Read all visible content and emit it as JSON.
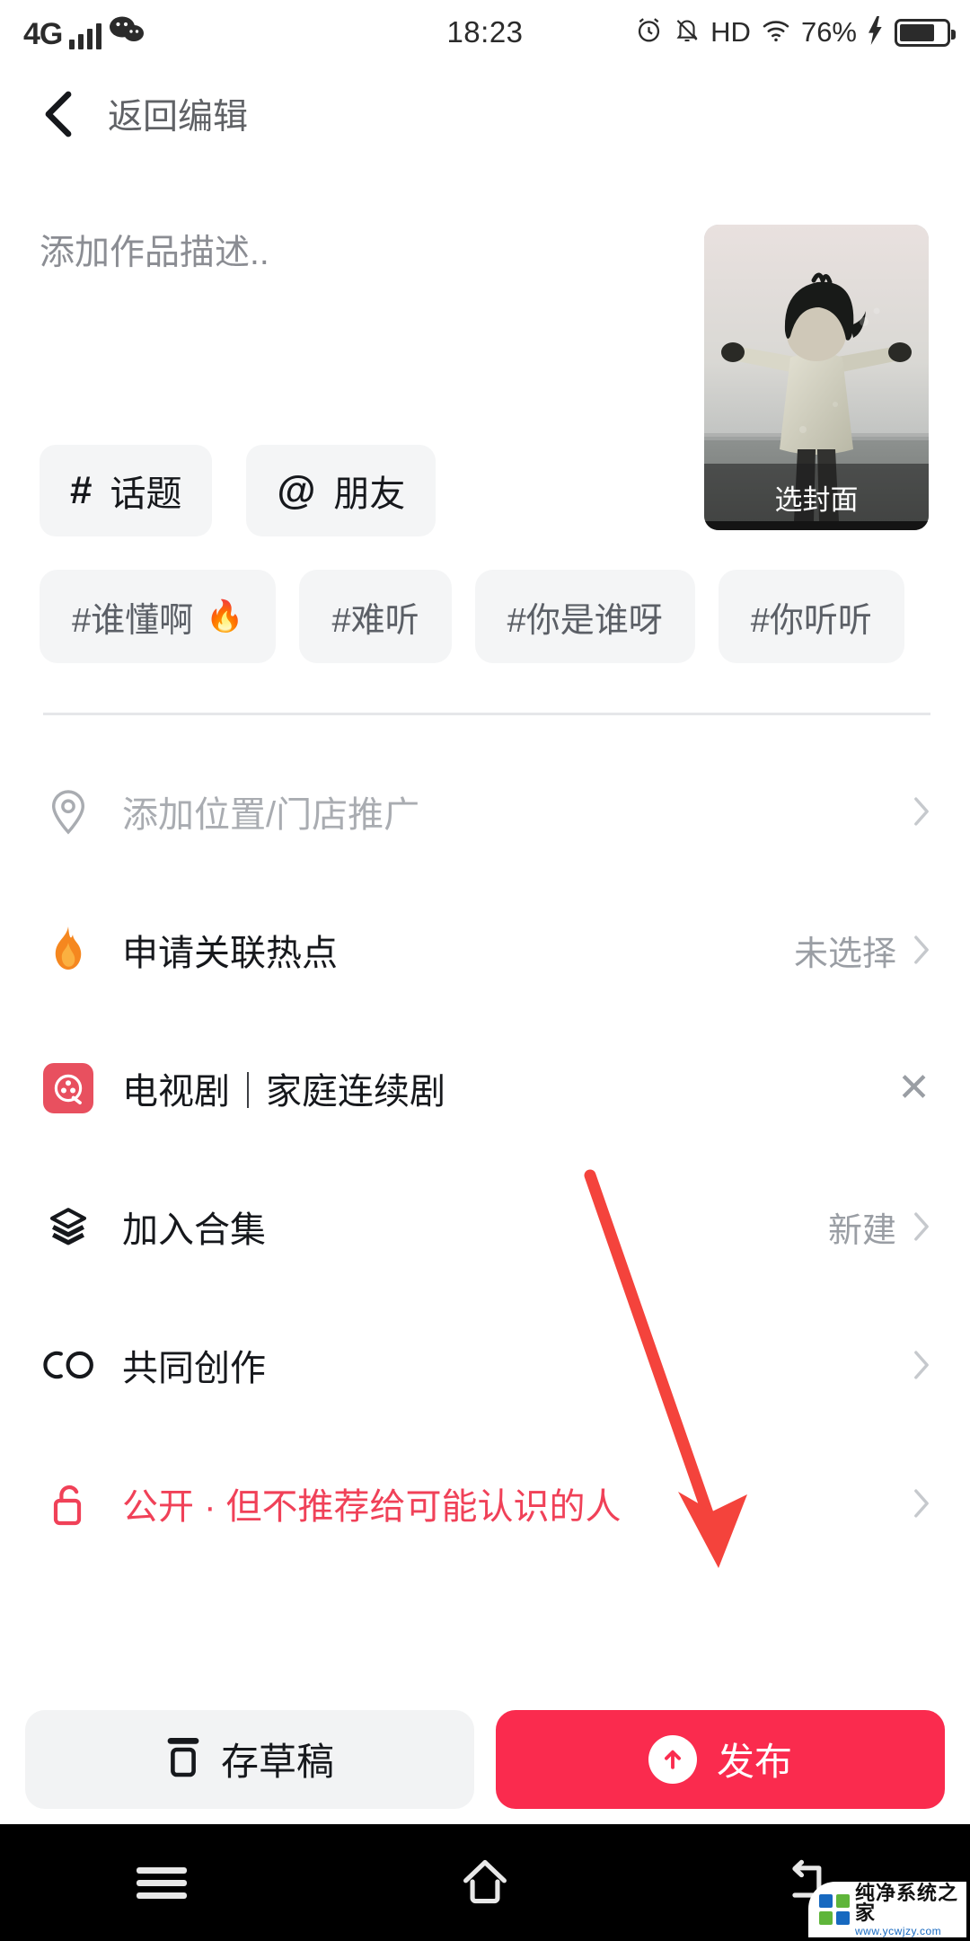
{
  "status_bar": {
    "network": "4G",
    "signal_icon": "signal-bars-icon",
    "app_badge_icon": "wechat-icon",
    "time": "18:23",
    "alarm_icon": "alarm-clock-icon",
    "mute_icon": "bell-muted-icon",
    "hd_label": "HD",
    "wifi_icon": "wifi-icon",
    "battery_percent": "76%",
    "charging_icon": "lightning-bolt-icon",
    "battery_icon": "battery-icon"
  },
  "header": {
    "back_icon": "back-chevron-icon",
    "title": "返回编辑"
  },
  "composer": {
    "description_placeholder": "添加作品描述..",
    "description_value": "添加作品描述..",
    "cover": {
      "label": "选封面",
      "image_alt": "child-with-outstretched-arms"
    },
    "quick_actions": [
      {
        "glyph": "#",
        "icon": "hash-icon",
        "label": "话题"
      },
      {
        "glyph": "@",
        "icon": "at-icon",
        "label": "朋友"
      }
    ],
    "suggested_tags": [
      {
        "label": "#谁懂啊",
        "hot": "🔥"
      },
      {
        "label": "#难听",
        "hot": ""
      },
      {
        "label": "#你是谁呀",
        "hot": ""
      },
      {
        "label": "#你听听",
        "hot": ""
      }
    ]
  },
  "options": [
    {
      "icon": "location-pin-icon",
      "label": "添加位置/门店推广",
      "label_muted": true,
      "value": "",
      "accessory": "chevron-right-icon"
    },
    {
      "icon": "flame-icon",
      "label": "申请关联热点",
      "label_muted": false,
      "value": "未选择",
      "accessory": "chevron-right-icon"
    },
    {
      "icon": "tv-drama-icon",
      "label": "电视剧｜家庭连续剧",
      "label_muted": false,
      "value": "",
      "accessory": "close-icon"
    },
    {
      "icon": "layers-icon",
      "label": "加入合集",
      "label_muted": false,
      "value": "新建",
      "accessory": "chevron-right-icon"
    },
    {
      "icon": "co-create-icon",
      "label": "共同创作",
      "label_muted": false,
      "value": "",
      "accessory": "chevron-right-icon"
    },
    {
      "icon": "unlock-icon",
      "label": "公开 · 但不推荐给可能认识的人",
      "label_muted": false,
      "label_danger": true,
      "value": "",
      "accessory": "chevron-right-icon"
    }
  ],
  "bottom_bar": {
    "draft": {
      "icon": "save-draft-icon",
      "label": "存草稿"
    },
    "publish": {
      "icon": "upload-arrow-icon",
      "label": "发布"
    }
  },
  "nav_bar": {
    "recents_icon": "menu-icon",
    "home_icon": "home-icon",
    "back_icon": "back-arrow-icon"
  },
  "watermark": {
    "name": "纯净系统之家",
    "url": "www.ycwjzy.com"
  },
  "annotation": {
    "arrow_color": "#f4433c",
    "type": "pointer-arrow"
  },
  "colors": {
    "accent_red": "#fa2b4e",
    "danger_text": "#f04158",
    "chip_bg": "#f4f5f6",
    "muted_text": "#a9acb1"
  }
}
